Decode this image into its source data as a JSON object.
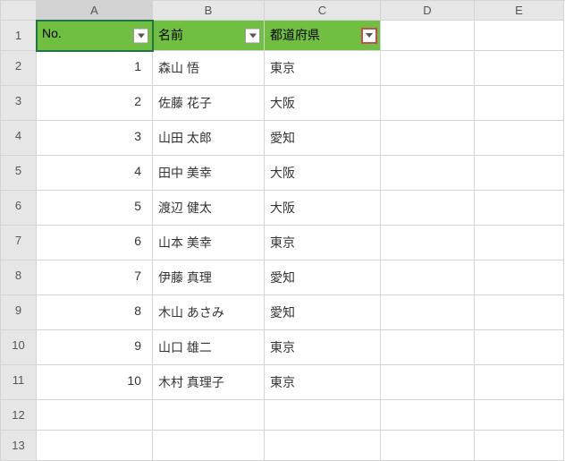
{
  "columns": [
    "A",
    "B",
    "C",
    "D",
    "E"
  ],
  "row_headers": [
    "1",
    "2",
    "3",
    "4",
    "5",
    "6",
    "7",
    "8",
    "9",
    "10",
    "11",
    "12",
    "13"
  ],
  "header_row": {
    "no": "No.",
    "name": "名前",
    "pref": "都道府県"
  },
  "chart_data": {
    "type": "table",
    "columns": [
      "No.",
      "名前",
      "都道府県"
    ],
    "rows": [
      {
        "no": "1",
        "name": "森山 悟",
        "pref": "東京"
      },
      {
        "no": "2",
        "name": "佐藤 花子",
        "pref": "大阪"
      },
      {
        "no": "3",
        "name": "山田 太郎",
        "pref": "愛知"
      },
      {
        "no": "4",
        "name": "田中 美幸",
        "pref": "大阪"
      },
      {
        "no": "5",
        "name": "渡辺 健太",
        "pref": "大阪"
      },
      {
        "no": "6",
        "name": "山本 美幸",
        "pref": "東京"
      },
      {
        "no": "7",
        "name": "伊藤 真理",
        "pref": "愛知"
      },
      {
        "no": "8",
        "name": "木山 あさみ",
        "pref": "愛知"
      },
      {
        "no": "9",
        "name": "山口 雄二",
        "pref": "東京"
      },
      {
        "no": "10",
        "name": "木村 真理子",
        "pref": "東京"
      }
    ]
  }
}
